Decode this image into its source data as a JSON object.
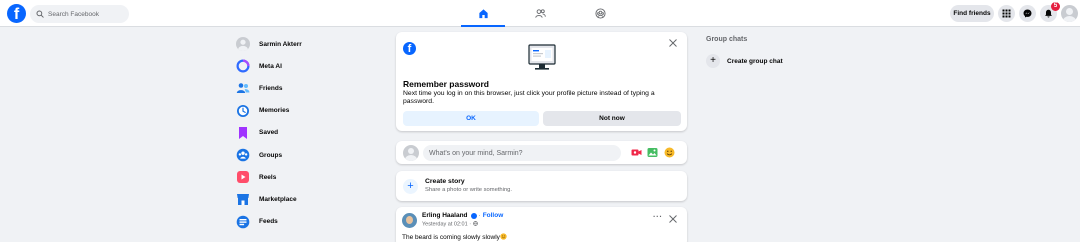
{
  "topbar": {
    "logo": "f",
    "search_placeholder": "Search Facebook",
    "find_friends": "Find friends",
    "notification_count": "5"
  },
  "sidebar": {
    "items": [
      {
        "label": "Sarmin Akterr",
        "icon": "user-avatar"
      },
      {
        "label": "Meta AI",
        "icon": "meta-ai-icon"
      },
      {
        "label": "Friends",
        "icon": "friends-icon"
      },
      {
        "label": "Memories",
        "icon": "memories-icon"
      },
      {
        "label": "Saved",
        "icon": "saved-icon"
      },
      {
        "label": "Groups",
        "icon": "groups-icon"
      },
      {
        "label": "Reels",
        "icon": "reels-icon"
      },
      {
        "label": "Marketplace",
        "icon": "marketplace-icon"
      },
      {
        "label": "Feeds",
        "icon": "feeds-icon"
      }
    ]
  },
  "password_card": {
    "title": "Remember password",
    "description": "Next time you log in on this browser, just click your profile picture instead of typing a password.",
    "ok": "OK",
    "not_now": "Not now"
  },
  "composer": {
    "placeholder": "What's on your mind, Sarmin?"
  },
  "story": {
    "title": "Create story",
    "subtitle": "Share a photo or write something."
  },
  "post": {
    "author": "Erling Haaland",
    "follow": "Follow",
    "time": "Yesterday at 02:01 ·",
    "text": "The beard is coming slowly slowly",
    "more": "···"
  },
  "right": {
    "heading": "Group chats",
    "create": "Create group chat"
  },
  "colors": {
    "brand": "#0866ff",
    "background": "#f0f2f5",
    "notification": "#e41e3f"
  }
}
